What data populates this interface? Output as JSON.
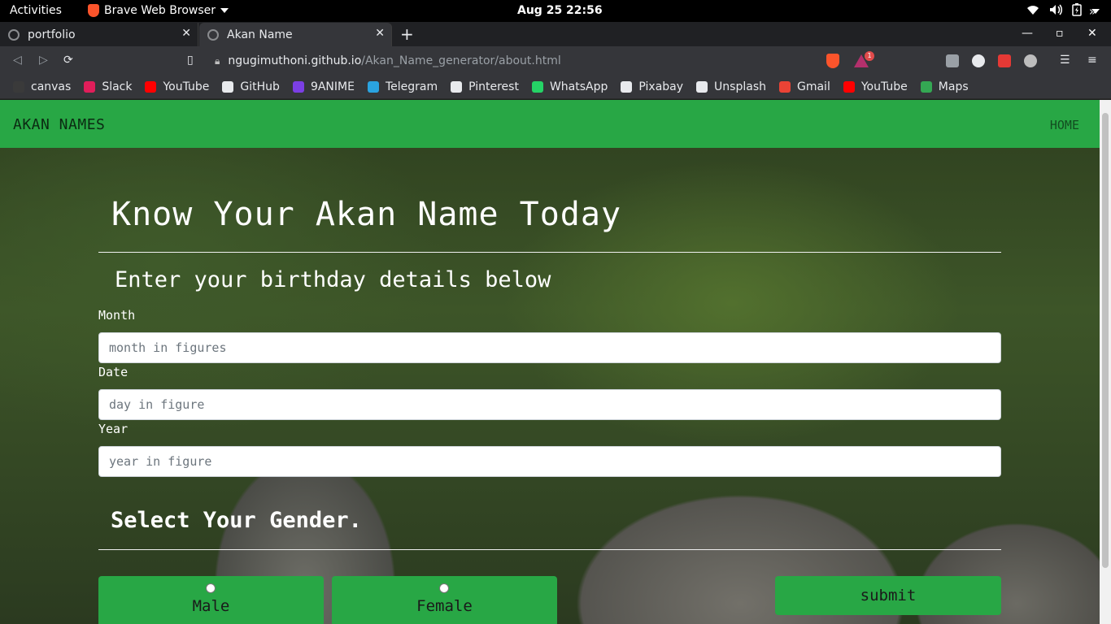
{
  "system_bar": {
    "activities": "Activities",
    "app_name": "Brave Web Browser",
    "clock": "Aug 25  22:56"
  },
  "tabs": [
    {
      "title": "portfolio",
      "active": false
    },
    {
      "title": "Akan Name",
      "active": true
    }
  ],
  "address_bar": {
    "host": "ngugimuthoni.github.io",
    "path": "/Akan_Name_generator/about.html",
    "rewards_badge": "1"
  },
  "bookmarks": [
    {
      "label": "canvas",
      "color": "#3a3a3a"
    },
    {
      "label": "Slack",
      "color": "#e01e5a"
    },
    {
      "label": "YouTube",
      "color": "#ff0000"
    },
    {
      "label": "GitHub",
      "color": "#e8eaed"
    },
    {
      "label": "9ANIME",
      "color": "#7b3fe4"
    },
    {
      "label": "Telegram",
      "color": "#2aa3df"
    },
    {
      "label": "Pinterest",
      "color": "#e8eaed"
    },
    {
      "label": "WhatsApp",
      "color": "#25d366"
    },
    {
      "label": "Pixabay",
      "color": "#e8eaed"
    },
    {
      "label": "Unsplash",
      "color": "#e8eaed"
    },
    {
      "label": "Gmail",
      "color": "#ea4335"
    },
    {
      "label": "YouTube",
      "color": "#ff0000"
    },
    {
      "label": "Maps",
      "color": "#34a853"
    }
  ],
  "site": {
    "brand": "AKAN NAMES",
    "nav_home": "HOME",
    "heading": "Know Your Akan Name Today",
    "subheading": "Enter your birthday details below",
    "month": {
      "label": "Month",
      "placeholder": "month in figures"
    },
    "date": {
      "label": "Date",
      "placeholder": "day in figure"
    },
    "year": {
      "label": "Year",
      "placeholder": "year in figure"
    },
    "gender_heading": "Select Your Gender.",
    "male": "Male",
    "female": "Female",
    "submit": "submit",
    "accent_color": "#28a745"
  }
}
